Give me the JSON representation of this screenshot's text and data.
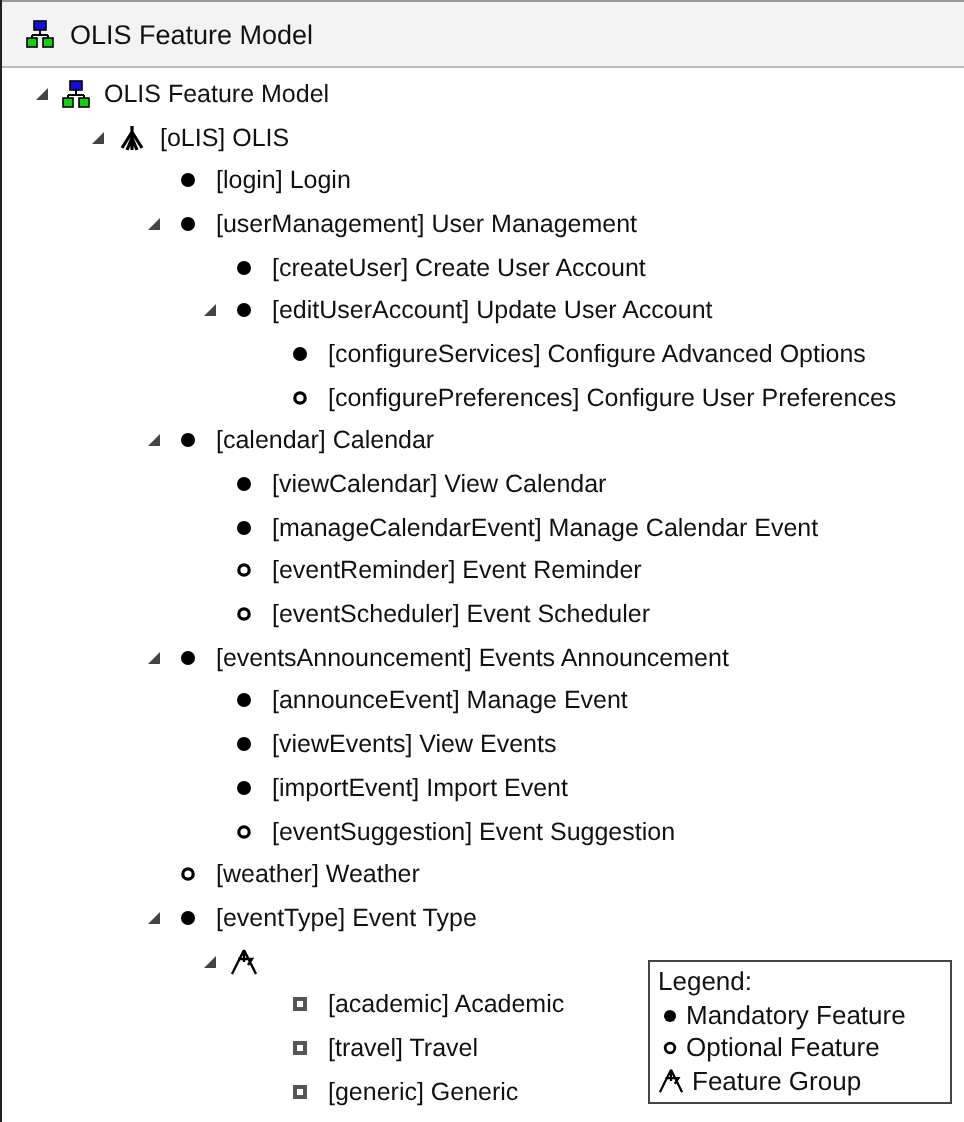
{
  "window": {
    "title": "OLIS Feature Model"
  },
  "tree": [
    {
      "kind": "model",
      "label": "OLIS Feature Model",
      "expanded": true,
      "children": [
        {
          "kind": "root",
          "label": "[oLIS] OLIS",
          "expanded": true,
          "children": [
            {
              "kind": "mandatory",
              "label": "[login] Login"
            },
            {
              "kind": "mandatory",
              "label": "[userManagement] User Management",
              "expanded": true,
              "children": [
                {
                  "kind": "mandatory",
                  "label": "[createUser] Create User Account"
                },
                {
                  "kind": "mandatory",
                  "label": "[editUserAccount] Update User Account",
                  "expanded": true,
                  "children": [
                    {
                      "kind": "mandatory",
                      "label": "[configureServices] Configure Advanced Options"
                    },
                    {
                      "kind": "optional",
                      "label": "[configurePreferences] Configure User Preferences"
                    }
                  ]
                }
              ]
            },
            {
              "kind": "mandatory",
              "label": "[calendar] Calendar",
              "expanded": true,
              "children": [
                {
                  "kind": "mandatory",
                  "label": "[viewCalendar] View Calendar"
                },
                {
                  "kind": "mandatory",
                  "label": "[manageCalendarEvent] Manage Calendar Event"
                },
                {
                  "kind": "optional",
                  "label": "[eventReminder] Event Reminder"
                },
                {
                  "kind": "optional",
                  "label": "[eventScheduler] Event Scheduler"
                }
              ]
            },
            {
              "kind": "mandatory",
              "label": "[eventsAnnouncement] Events Announcement",
              "expanded": true,
              "children": [
                {
                  "kind": "mandatory",
                  "label": "[announceEvent] Manage Event"
                },
                {
                  "kind": "mandatory",
                  "label": "[viewEvents] View Events"
                },
                {
                  "kind": "mandatory",
                  "label": "[importEvent] Import Event"
                },
                {
                  "kind": "optional",
                  "label": "[eventSuggestion] Event Suggestion"
                }
              ]
            },
            {
              "kind": "optional",
              "label": "[weather] Weather"
            },
            {
              "kind": "mandatory",
              "label": "[eventType] Event Type",
              "expanded": true,
              "children": [
                {
                  "kind": "group",
                  "expanded": true,
                  "children": [
                    {
                      "kind": "alternative",
                      "label": "[academic] Academic"
                    },
                    {
                      "kind": "alternative",
                      "label": "[travel] Travel"
                    },
                    {
                      "kind": "alternative",
                      "label": "[generic] Generic"
                    }
                  ]
                }
              ]
            }
          ]
        }
      ]
    }
  ],
  "legend": {
    "title": "Legend:",
    "entries": [
      {
        "kind": "mandatory",
        "label": "Mandatory Feature"
      },
      {
        "kind": "optional",
        "label": "Optional Feature"
      },
      {
        "kind": "group",
        "label": "Feature Group"
      }
    ]
  }
}
